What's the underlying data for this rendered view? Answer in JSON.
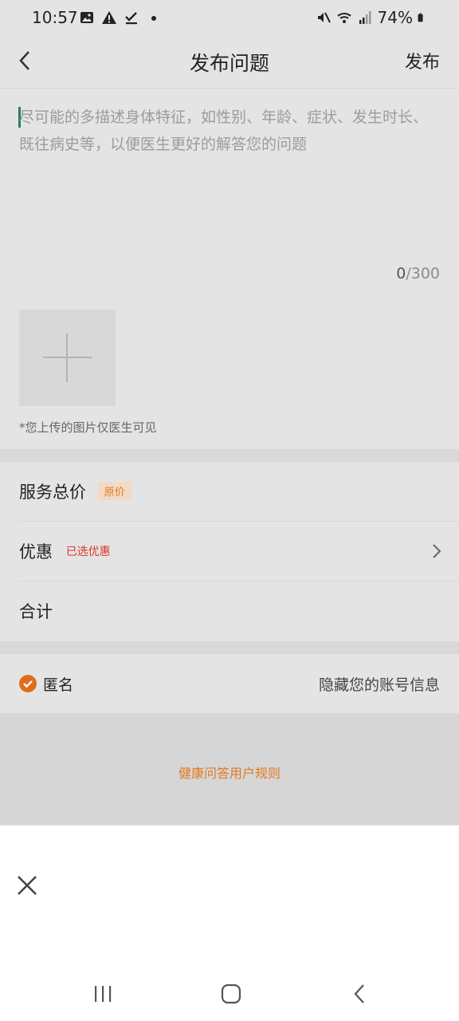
{
  "status_bar": {
    "time": "10:57",
    "battery": "74%"
  },
  "header": {
    "title": "发布问题",
    "publish_label": "发布"
  },
  "question": {
    "placeholder": "尽可能的多描述身体特征，如性别、年龄、症状、发生时长、既往病史等，以便医生更好的解答您的问题",
    "counter_current": "0",
    "counter_max": "/300"
  },
  "upload": {
    "note": "*您上传的图片仅医生可见"
  },
  "pricing": {
    "total_label": "服务总价",
    "total_badge": "原价",
    "discount_label": "优惠",
    "discount_status": "已选优惠",
    "sum_label": "合计"
  },
  "anonymous": {
    "label": "匿名",
    "hint": "隐藏您的账号信息",
    "checked": true
  },
  "footer": {
    "rules_link": "健康问答用户规则"
  },
  "colors": {
    "accent": "#e07a1e",
    "red": "#d8382b",
    "cursor": "#2f7d5b"
  }
}
